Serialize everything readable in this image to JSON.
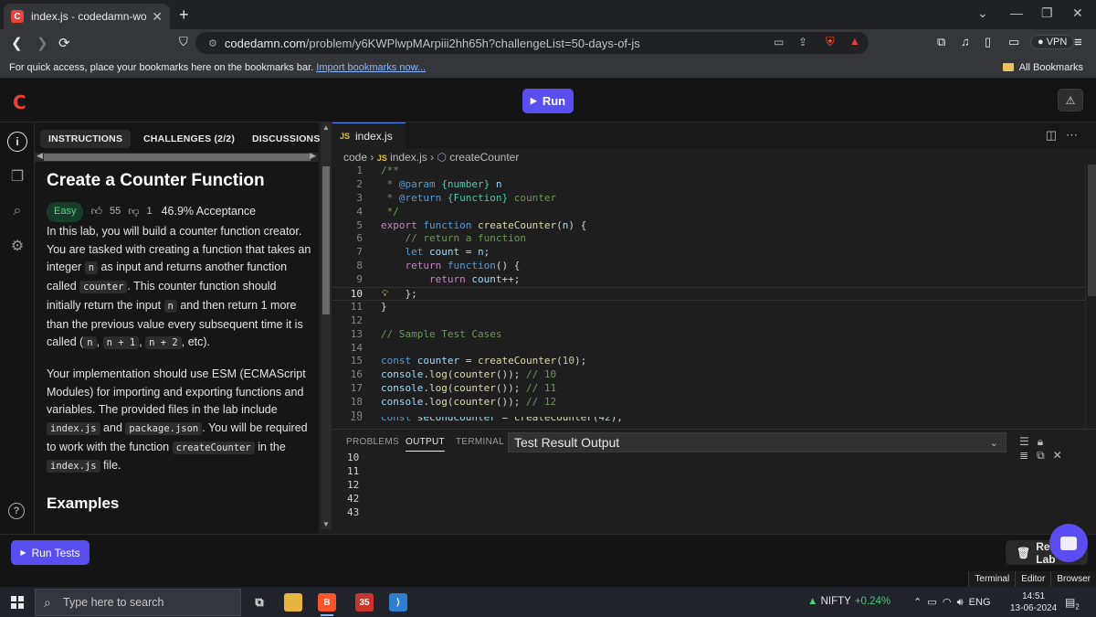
{
  "browser": {
    "tab_title": "index.js - codedamn-workspace",
    "favicon_letter": "C",
    "url_host": "codedamn.com",
    "url_path": "/problem/y6KWPlwpMArpiii2hh65h?challengeList=50-days-of-js",
    "vpn_label": "VPN",
    "bookmarks_message": "For quick access, place your bookmarks here on the bookmarks bar.",
    "bookmarks_link": "Import bookmarks now...",
    "all_bookmarks": "All Bookmarks"
  },
  "app": {
    "logo": "C",
    "run_label": "Run",
    "run_tests_label": "Run Tests",
    "reset_label": "Reset Lab"
  },
  "left": {
    "tabs": [
      "INSTRUCTIONS",
      "CHALLENGES (2/2)",
      "DISCUSSIONS"
    ],
    "title": "Create a Counter Function",
    "difficulty": "Easy",
    "likes": "55",
    "dislikes": "1",
    "acceptance": "46.9% Acceptance",
    "p1_a": "In this lab, you will build a counter function creator. You are tasked with creating a function that takes an integer ",
    "p1_code1": "n",
    "p1_b": " as input and returns another function called ",
    "p1_code2": "counter",
    "p1_c": ". This counter function should initially return the input ",
    "p1_code3": "n",
    "p1_d": " and then return 1 more than the previous value every subsequent time it is called (",
    "p1_code4": "n",
    "p1_e": ", ",
    "p1_code5": "n + 1",
    "p1_f": ", ",
    "p1_code6": "n + 2",
    "p1_g": ", etc).",
    "p2_a": "Your implementation should use ESM (ECMAScript Modules) for importing and exporting functions and variables. The provided files in the lab include ",
    "p2_code1": "index.js",
    "p2_b": " and ",
    "p2_code2": "package.json",
    "p2_c": ". You will be required to work with the function ",
    "p2_code3": "createCounter",
    "p2_d": " in the ",
    "p2_code4": "index.js",
    "p2_e": " file.",
    "examples_heading": "Examples"
  },
  "editor": {
    "tab_name": "index.js",
    "js_badge": "JS",
    "crumb_root": "code",
    "crumb_file": "index.js",
    "crumb_symbol": "createCounter",
    "current_line": 10
  },
  "panel": {
    "tabs": [
      "PROBLEMS",
      "OUTPUT",
      "TERMINAL"
    ],
    "active_tab": "OUTPUT",
    "select_value": "Test Result Output",
    "output_lines": [
      "10",
      "11",
      "12",
      "42",
      "43"
    ]
  },
  "bottom_tabs": [
    "Terminal",
    "Editor",
    "Browser"
  ],
  "taskbar": {
    "search_placeholder": "Type here to search",
    "ticker_name": "NIFTY",
    "ticker_change": "+0.24%",
    "language": "ENG",
    "time": "14:51",
    "date": "13-06-2024",
    "notification_count": "2"
  }
}
